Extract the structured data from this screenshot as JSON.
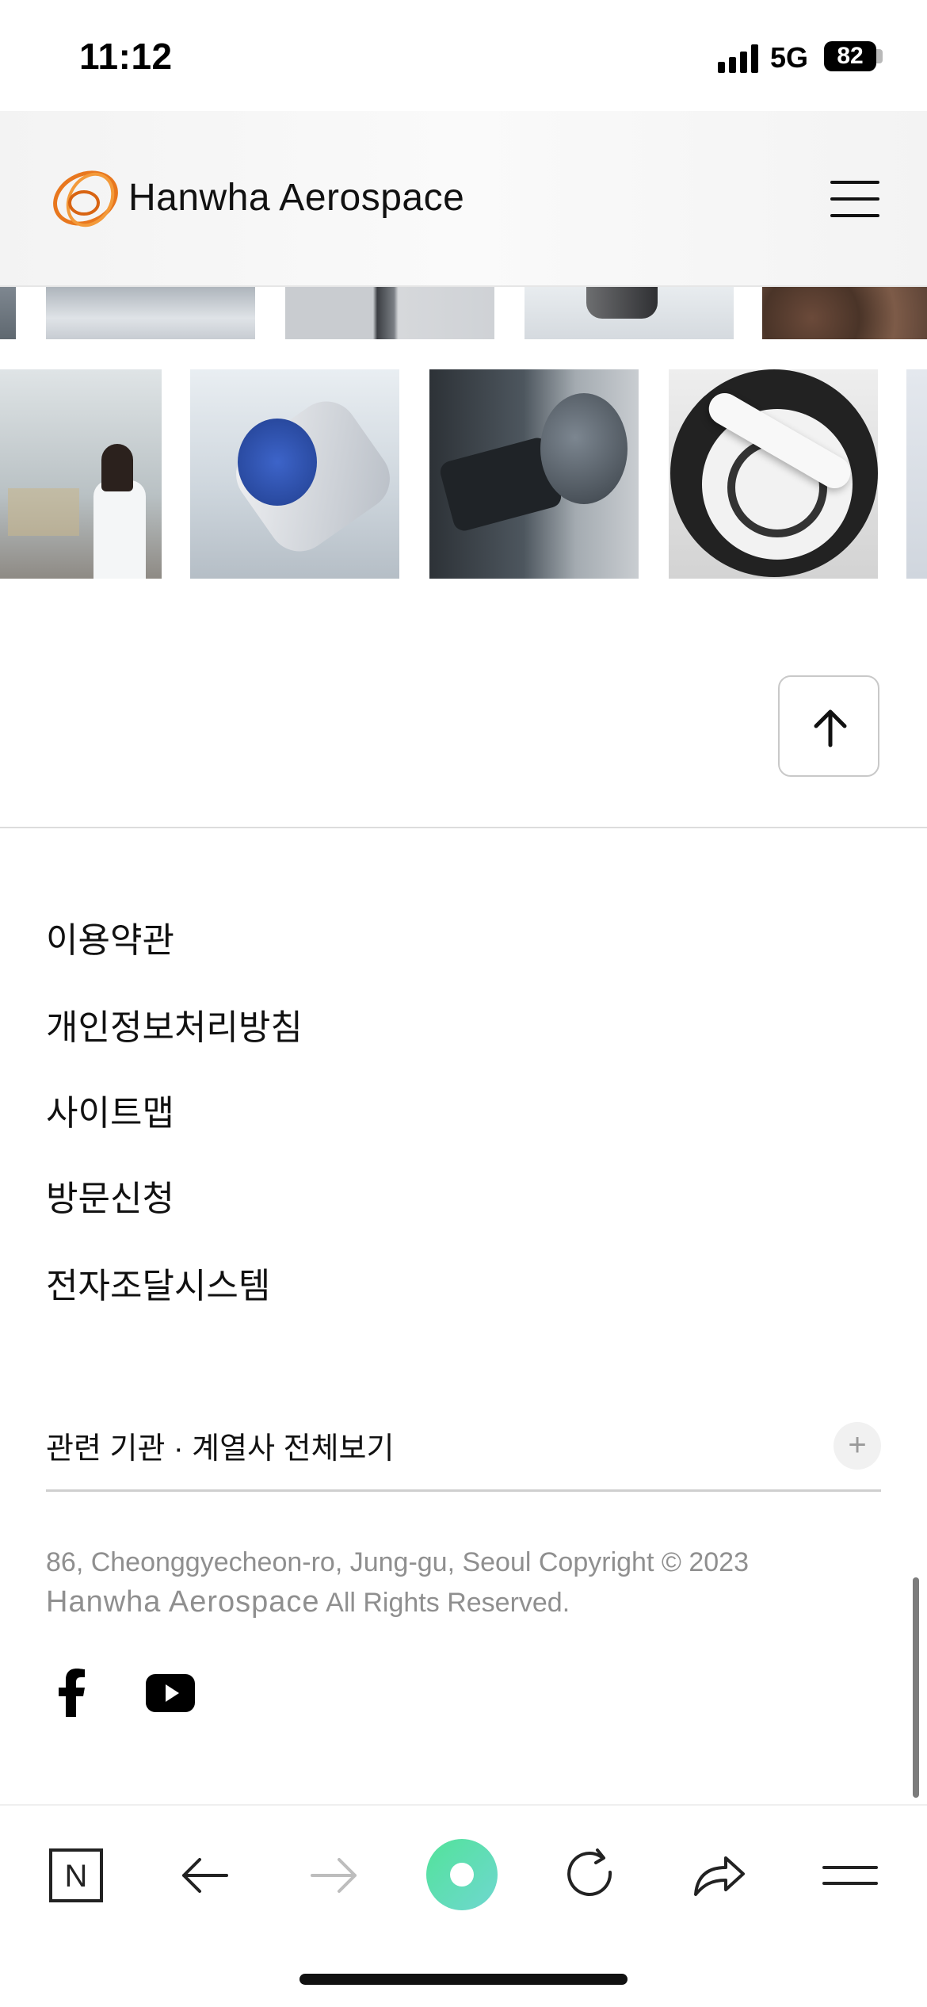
{
  "status_bar": {
    "time": "11:12",
    "network": "5G",
    "battery": "82"
  },
  "header": {
    "logo_text": "Hanwha Aerospace",
    "menu_icon": "hamburger-icon"
  },
  "gallery": {
    "row1": [
      "parts-photo",
      "rod-photo",
      "glass-photo",
      "rocks-photo"
    ],
    "row2": [
      "lab-scientist-photo",
      "engine-photo",
      "microscope-photo",
      "drone-helipad-photo",
      "edge-photo"
    ]
  },
  "scroll_top": {
    "icon": "arrow-up-icon"
  },
  "footer": {
    "links": [
      "이용약관",
      "개인정보처리방침",
      "사이트맵",
      "방문신청",
      "전자조달시스템"
    ],
    "related_label": "관련 기관 · 계열사 전체보기",
    "related_toggle": "+",
    "address": "86, Cheonggyecheon-ro, Jung-gu, Seoul Copyright © 2023",
    "brand": "Hanwha Aerospace",
    "rights": "All Rights Reserved.",
    "social": [
      "facebook-icon",
      "youtube-icon"
    ]
  },
  "browser_toolbar": {
    "icons": [
      "naver-icon",
      "back-arrow-icon",
      "forward-arrow-icon",
      "green-dot-icon",
      "reload-icon",
      "share-icon",
      "menu-icon"
    ],
    "colors": {
      "accent_green": "#6fe0a0"
    }
  },
  "colors": {
    "logo_orange": "#e8771e",
    "text": "#111111",
    "muted": "#8f8f8f"
  }
}
